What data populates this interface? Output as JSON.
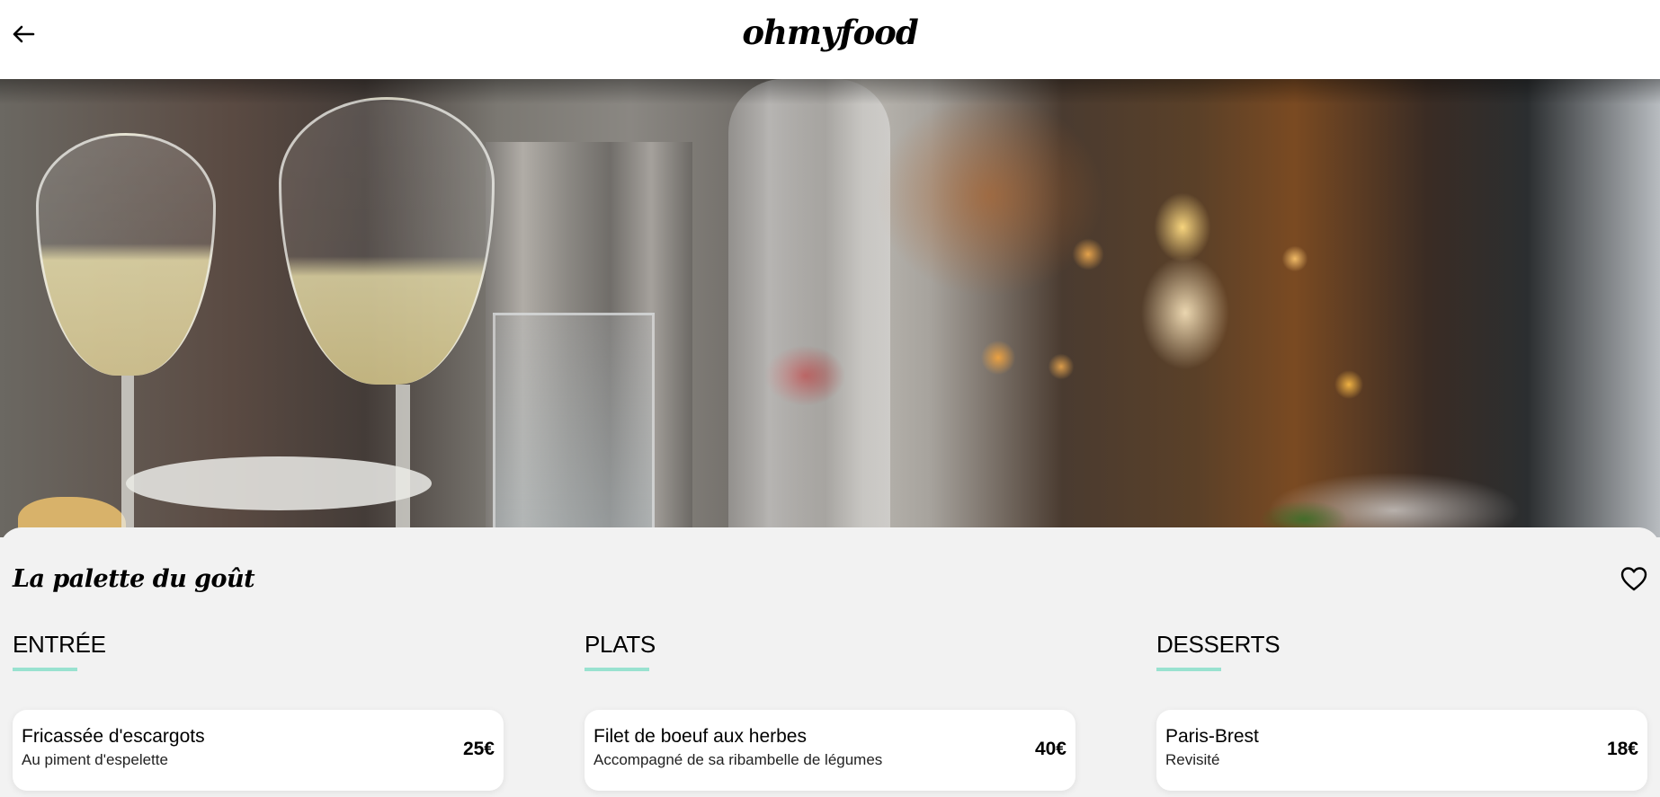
{
  "header": {
    "back_icon": "arrow-left-icon",
    "logo": "ohmyfood"
  },
  "hero": {
    "image": "restaurant-table-photo"
  },
  "restaurant": {
    "name": "La palette du goût",
    "like_icon": "heart-outline-icon"
  },
  "accent_color": "#99e2d0",
  "menu": {
    "sections": [
      {
        "title": "ENTRÉE",
        "dishes": [
          {
            "name": "Fricassée d'escargots",
            "description": "Au piment d'espelette",
            "price": "25€"
          }
        ]
      },
      {
        "title": "PLATS",
        "dishes": [
          {
            "name": "Filet de boeuf aux herbes",
            "description": "Accompagné de sa ribambelle de légumes",
            "price": "40€"
          }
        ]
      },
      {
        "title": "DESSERTS",
        "dishes": [
          {
            "name": "Paris-Brest",
            "description": "Revisité",
            "price": "18€"
          }
        ]
      }
    ]
  }
}
